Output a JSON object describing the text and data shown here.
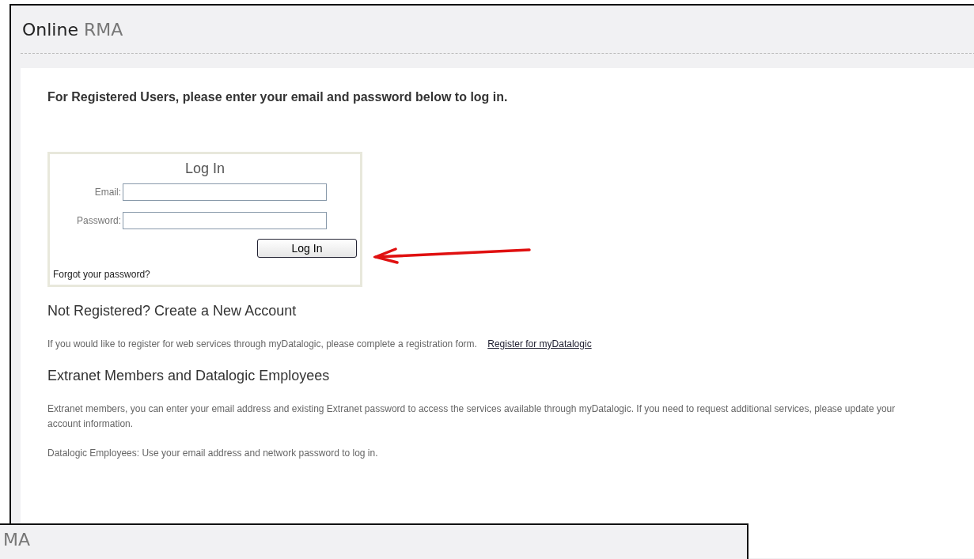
{
  "header": {
    "title_strong": "Online",
    "title_light": "RMA"
  },
  "intro": "For Registered Users, please enter your email and password below to log in.",
  "login": {
    "title": "Log In",
    "fields": [
      {
        "label": "Email:"
      },
      {
        "label": "Password:"
      }
    ],
    "button": "Log In",
    "forgot": "Forgot your password?"
  },
  "register": {
    "heading": "Not Registered? Create a New Account",
    "text": "If you would like to register for web services through myDatalogic, please complete a registration form.",
    "link": "Register for myDatalogic"
  },
  "extranet": {
    "heading": "Extranet Members and Datalogic Employees",
    "paragraphs": [
      "Extranet members, you can enter your email address and existing Extranet password to access the services available through myDatalogic. If you need to request additional services, please update your account information.",
      "Datalogic Employees: Use your email address and network password to log in."
    ]
  },
  "overlay": {
    "title": "MA"
  }
}
